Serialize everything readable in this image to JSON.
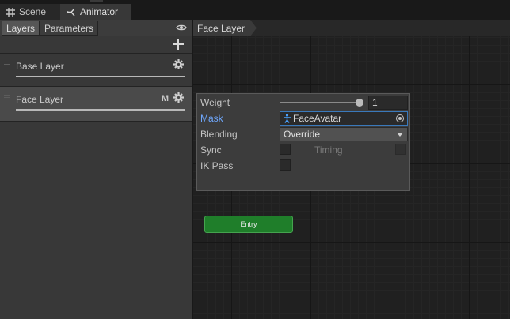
{
  "tabs": [
    {
      "label": "Scene",
      "icon": "grid-icon",
      "active": false
    },
    {
      "label": "Animator",
      "icon": "animator-icon",
      "active": true
    }
  ],
  "left_panel": {
    "tabs": [
      "Layers",
      "Parameters"
    ],
    "active_tab": "Layers",
    "eye_icon": "eye-icon",
    "add_icon": "plus-icon",
    "layers": [
      {
        "name": "Base Layer",
        "tag": "",
        "selected": false
      },
      {
        "name": "Face Layer",
        "tag": "M",
        "selected": true
      }
    ]
  },
  "graph": {
    "breadcrumb": "Face Layer",
    "layer_settings": {
      "weight_label": "Weight",
      "weight_value": "1",
      "weight_fraction": 1,
      "mask_label": "Mask",
      "mask_value": "FaceAvatar",
      "blending_label": "Blending",
      "blending_value": "Override",
      "sync_label": "Sync",
      "sync_checked": false,
      "timing_label": "Timing",
      "timing_checked": false,
      "ikpass_label": "IK Pass",
      "ikpass_checked": false
    },
    "entry_node": "Entry"
  },
  "colors": {
    "entry_fill": "#1f7e2a",
    "mask_label": "#6fa8ff",
    "focus_border": "#3a79bb"
  }
}
